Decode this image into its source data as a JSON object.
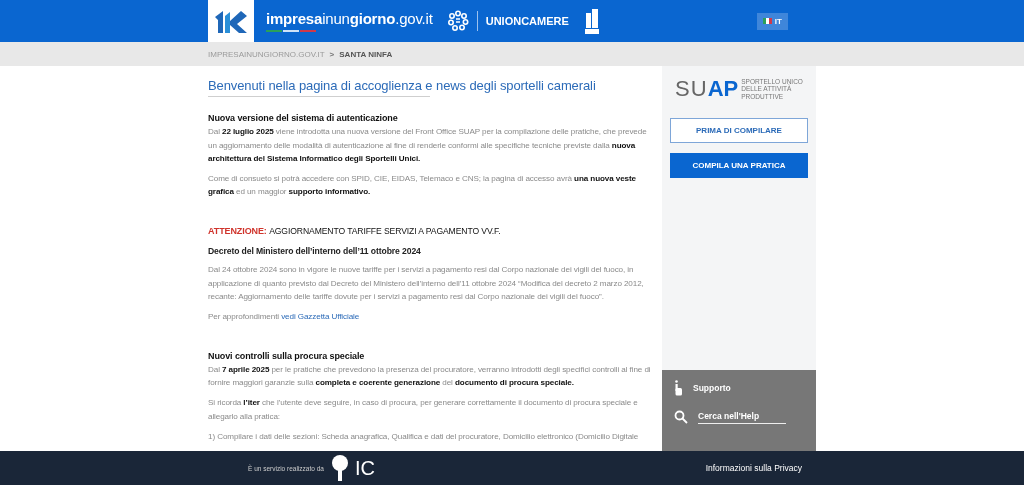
{
  "header": {
    "site_name": "**impresa**inun**giorno**.gov.it",
    "partner": "UNIONCAMERE",
    "language": "IT"
  },
  "breadcrumb": [
    {
      "label": "IMPRESAINUNGIORNO.GOV.IT",
      "current": false
    },
    {
      "label": "SANTA NINFA",
      "current": true
    }
  ],
  "breadcrumb_separator": ">",
  "page_title": "Benvenuti nella pagina di accoglienza e news degli sportelli camerali",
  "news": [
    {
      "title": "Nuova versione del sistema di autenticazione",
      "paragraphs": [
        "Dal  **22 luglio 2025** viene introdotta una nuova versione del Front Office SUAP per la compilazione delle pratiche, che prevede un aggiornamento delle modalità di autenticazione al fine di renderle conformi alle specifiche tecniche previste dalla **nuova architettura del Sistema Informatico degli Sportelli Unici.**",
        "Come di consueto si potrà accedere con SPID, CIE, EIDAS, Telemaco e CNS; la pagina di accesso avrà **una nuova veste grafica** ed un maggior **supporto informativo.**"
      ]
    },
    {
      "attention_label": "ATTENZIONE:",
      "title": "AGGIORNAMENTO TARIFFE SERVIZI A PAGAMENTO VV.F.",
      "subtitle": "Decreto del Ministero dell’interno dell’11 ottobre 2024",
      "paragraphs": [
        "Dal 24 ottobre 2024 sono in vigore le nuove tariffe per i servizi a pagamento resi dal Corpo nazionale dei vigili del fuoco, in applicazione di quanto previsto dal Decreto del Ministero dell’interno dell’11 ottobre 2024  “Modifica del decreto 2 marzo 2012, recante: Aggiornamento delle tariffe dovute per i servizi a pagamento resi dal Corpo nazionale dei vigili del fuoco”."
      ],
      "more": {
        "text": "Per approfondimenti ",
        "link": "vedi Gazzetta Ufficiale"
      }
    },
    {
      "title": "Nuovi controlli sulla procura speciale",
      "paragraphs": [
        "Dal  **7 aprile 2025** per le pratiche che prevedono la presenza del procuratore, verranno introdotti degli specifici controlli al fine di fornire maggiori garanzie sulla **completa e coerente generazione** del **documento di procura speciale.**",
        "Si ricorda **l’iter** che l’utente deve seguire, in caso di procura, per generare correttamente il documento di procura speciale e allegarlo alla pratica:",
        "1) Compilare i dati delle sezioni: Scheda anagrafica, Qualifica e dati del procuratore, Domicilio elettronico (Domicilio Digitale"
      ]
    }
  ],
  "sidebar": {
    "logo_main": "SU",
    "logo_accent": "AP",
    "logo_caption": [
      "SPORTELLO UNICO",
      "DELLE ATTIVITÀ",
      "PRODUTTIVE"
    ],
    "buttons": [
      {
        "label": "PRIMA DI COMPILARE",
        "kind": "outline"
      },
      {
        "label": "COMPILA UNA PRATICA",
        "kind": "primary"
      }
    ],
    "support": "Supporto",
    "help_search": {
      "placeholder": "Cerca nell'Help"
    }
  },
  "footer": {
    "credit": "È un servizio realizzato da",
    "provider": "IC",
    "privacy": "Informazioni sulla Privacy"
  }
}
